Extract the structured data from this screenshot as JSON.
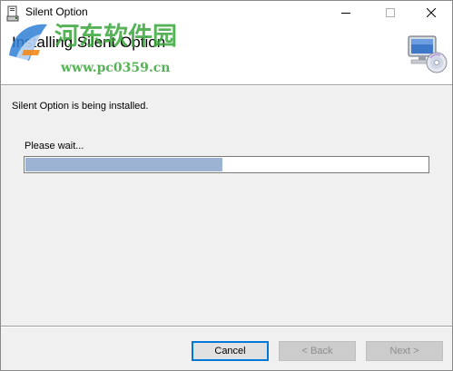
{
  "window": {
    "title": "Silent Option"
  },
  "banner": {
    "title": "Installing Silent Option"
  },
  "watermark": {
    "brand": "河东软件园",
    "url": "www.pc0359.cn"
  },
  "main": {
    "status_text": "Silent Option is being installed.",
    "wait_label": "Please wait...",
    "progress": 0.49
  },
  "buttons": {
    "cancel": "Cancel",
    "back": "< Back",
    "next": "Next >"
  },
  "colors": {
    "progress_fill": "#9cb3d3",
    "focus_border": "#0078d7",
    "watermark_green": "#3aa63a"
  },
  "icons": {
    "app": "installer-icon",
    "header": "computer-cd-icon",
    "minimize": "minimize-icon",
    "maximize": "maximize-icon",
    "close": "close-icon"
  }
}
